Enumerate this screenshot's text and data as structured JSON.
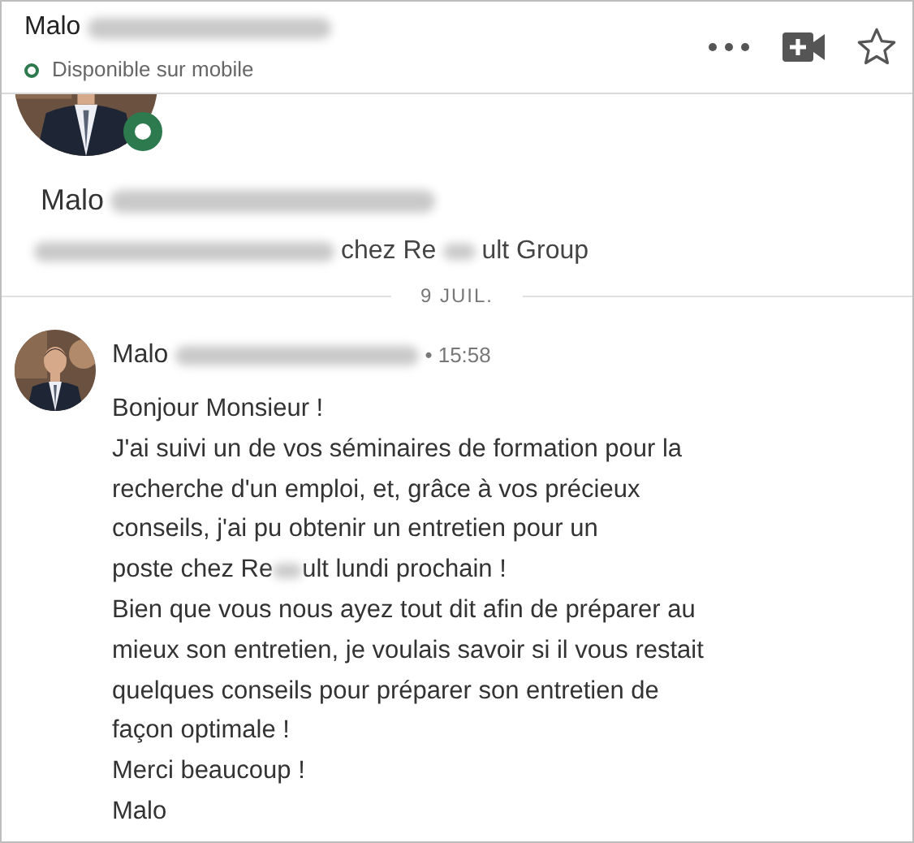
{
  "header": {
    "first_name": "Malo",
    "status": "Disponible sur mobile"
  },
  "profile": {
    "first_name": "Malo",
    "headline_after": "chez Re",
    "headline_end": "ult Group"
  },
  "date_divider": "9 JUIL.",
  "message": {
    "first_name": "Malo",
    "time": "• 15:58",
    "lines": [
      {
        "kind": "text",
        "text": "Bonjour Monsieur !"
      },
      {
        "kind": "text",
        "text": "J'ai suivi un de vos séminaires de formation pour la"
      },
      {
        "kind": "text",
        "text": "recherche d'un emploi, et, grâce à vos précieux"
      },
      {
        "kind": "text",
        "text": "conseils, j'ai pu obtenir un entretien pour un"
      },
      {
        "kind": "redacted",
        "before": "poste chez Re",
        "after": "ult lundi prochain !"
      },
      {
        "kind": "text",
        "text": "Bien que vous nous ayez tout dit afin de préparer au"
      },
      {
        "kind": "text",
        "text": "mieux son entretien, je voulais savoir si il vous restait"
      },
      {
        "kind": "text",
        "text": "quelques conseils pour préparer son entretien de"
      },
      {
        "kind": "text",
        "text": "façon optimale !"
      },
      {
        "kind": "text",
        "text": "Merci beaucoup !"
      },
      {
        "kind": "text",
        "text": "Malo"
      }
    ]
  }
}
